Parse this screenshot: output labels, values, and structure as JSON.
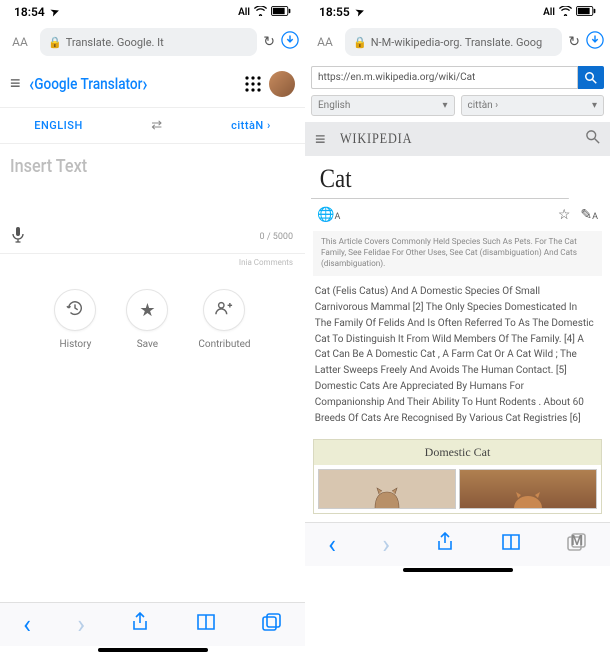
{
  "left": {
    "status": {
      "time": "18:54",
      "loc_icon": "➤",
      "right_text": "All",
      "wifi": "wifi-icon",
      "battery": "battery-icon"
    },
    "addr": {
      "aa": "AA",
      "lock": "🔒",
      "url": "Translate. Google. It",
      "refresh": "↻",
      "download": "⬇"
    },
    "header": {
      "menu": "≡",
      "title": "Google Translator",
      "apps": "⋮⋮⋮"
    },
    "langs": {
      "from": "ENGLISH",
      "swap": "⇄",
      "to": "cittàN ›"
    },
    "input": {
      "placeholder": "Insert Text"
    },
    "mic": {
      "icon": "🎤",
      "count": "0 / 5000"
    },
    "comments": "Inia Comments",
    "actions": {
      "history": {
        "icon": "↺",
        "label": "History"
      },
      "save": {
        "icon": "★",
        "label": "Save"
      },
      "contributed": {
        "icon": "👥",
        "label": "Contributed"
      }
    }
  },
  "right": {
    "status": {
      "time": "18:55",
      "loc_icon": "➤",
      "right_text": "All",
      "wifi": "wifi-icon",
      "battery": "battery-icon"
    },
    "addr": {
      "aa": "AA",
      "lock": "🔒",
      "url": "N-M-wikipedia-org. Translate. Goog",
      "refresh": "↻",
      "download": "⬇"
    },
    "search": {
      "value": "https://en.m.wikipedia.org/wiki/Cat",
      "btn_icon": "🔍"
    },
    "langsel": {
      "from": "English",
      "to": "cittàn ›"
    },
    "wiki_header": {
      "menu": "≡",
      "title": "WikipediA",
      "search": "🔍"
    },
    "article": {
      "title": "Cat",
      "tools": {
        "translate": "文A",
        "star": "☆",
        "edit": "✎A"
      },
      "hatnote": "This Article Covers Commonly Held Species Such As Pets. For The Cat Family, See Felidae For Other Uses, See Cat (disambiguation) And Cats (disambiguation).",
      "body": "Cat (Felis Catus) And A Domestic Species Of Small Carnivorous Mammal [2] The Only Species Domesticated In The Family Of Felids And Is Often Referred To As The Domestic Cat To Distinguish It From Wild Members Of The Family. [4] A Cat Can Be A Domestic Cat , A Farm Cat Or A Cat Wild ; The Latter Sweeps Freely And Avoids The Human Contact. [5] Domestic Cats Are Appreciated By Humans For Companionship And Their Ability To Hunt Rodents . About 60 Breeds Of Cats Are Recognised By Various Cat Registries [6]",
      "infobox_title": "Domestic Cat"
    }
  },
  "nav": {
    "back": "‹",
    "fwd": "›",
    "share": "⬆",
    "book": "⫿",
    "tabs": "⧉"
  }
}
